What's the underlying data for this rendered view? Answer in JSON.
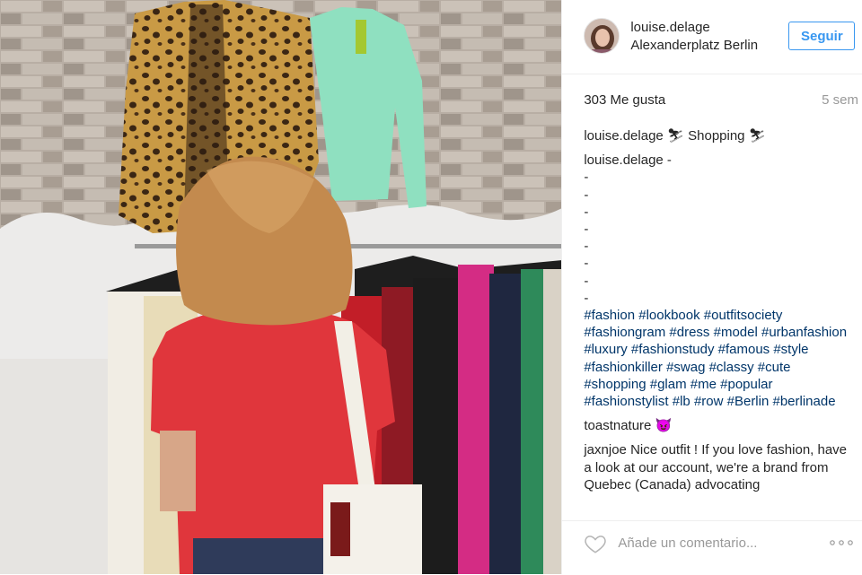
{
  "post": {
    "username": "louise.delage",
    "location": "Alexanderplatz Berlin",
    "follow_label": "Seguir",
    "likes": "303 Me gusta",
    "age": "5 sem"
  },
  "caption": {
    "user": "louise.delage",
    "text": "⛷ Shopping ⛷"
  },
  "comments": [
    {
      "user": "louise.delage",
      "text": "-",
      "dashes": [
        "-",
        "-",
        "-",
        "-",
        "-",
        "-",
        "-",
        "-"
      ],
      "hashtags": [
        "#fashion",
        "#lookbook",
        "#outfitsociety",
        "#fashiongram",
        "#dress",
        "#model",
        "#urbanfashion",
        "#luxury",
        "#fashionstudy",
        "#famous",
        "#style",
        "#fashionkiller",
        "#swag",
        "#classy",
        "#cute",
        "#shopping",
        "#glam",
        "#me",
        "#popular",
        "#fashionstylist",
        "#lb",
        "#row",
        "#Berlin",
        "#berlinade"
      ]
    },
    {
      "user": "toastnature",
      "text": "😈"
    },
    {
      "user": "jaxnjoe",
      "text": "Nice outfit ! If you love fashion, have a look at our account, we're a brand from Quebec (Canada) advocating"
    }
  ],
  "footer": {
    "comment_placeholder": "Añade un comentario...",
    "heart_icon": "heart-outline-icon",
    "more_icon": "ellipsis-icon"
  },
  "colors": {
    "accent": "#3897f0",
    "hashtag": "#003569",
    "muted": "#999999"
  }
}
